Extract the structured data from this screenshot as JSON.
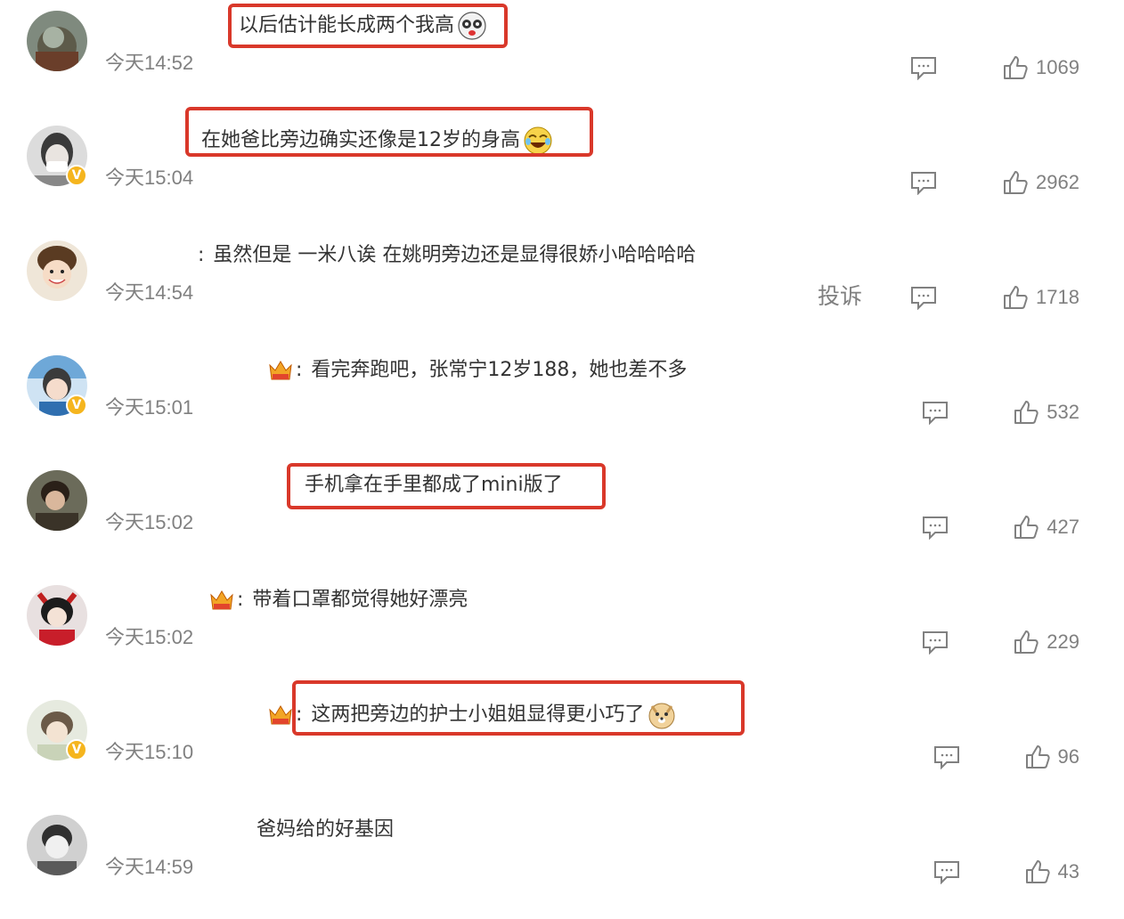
{
  "comments": [
    {
      "text": "以后估计能长成两个我高",
      "time": "今天14:52",
      "likes": "1069",
      "verified": false,
      "crown": false,
      "emoji": "panda-face-emoji",
      "highlighted": true,
      "report": ""
    },
    {
      "text": "在她爸比旁边确实还像是12岁的身高",
      "time": "今天15:04",
      "likes": "2962",
      "verified": true,
      "crown": false,
      "emoji": "laughing-tears-emoji",
      "highlighted": true,
      "report": ""
    },
    {
      "text": "虽然但是 一米八诶 在姚明旁边还是显得很娇小哈哈哈哈",
      "time": "今天14:54",
      "likes": "1718",
      "verified": false,
      "crown": false,
      "emoji": "",
      "highlighted": false,
      "report": "投诉"
    },
    {
      "text": "看完奔跑吧，张常宁12岁188，她也差不多",
      "time": "今天15:01",
      "likes": "532",
      "verified": true,
      "crown": true,
      "emoji": "",
      "highlighted": false,
      "report": ""
    },
    {
      "text": "手机拿在手里都成了mini版了",
      "time": "今天15:02",
      "likes": "427",
      "verified": false,
      "crown": false,
      "emoji": "",
      "highlighted": true,
      "report": ""
    },
    {
      "text": "带着口罩都觉得她好漂亮",
      "time": "今天15:02",
      "likes": "229",
      "verified": false,
      "crown": true,
      "emoji": "",
      "highlighted": false,
      "report": ""
    },
    {
      "text": "这两把旁边的护士小姐姐显得更小巧了",
      "time": "今天15:10",
      "likes": "96",
      "verified": true,
      "crown": true,
      "emoji": "doge-emoji",
      "highlighted": true,
      "report": ""
    },
    {
      "text": "爸妈给的好基因",
      "time": "今天14:59",
      "likes": "43",
      "verified": false,
      "crown": false,
      "emoji": "",
      "highlighted": false,
      "report": ""
    }
  ],
  "colors": {
    "highlight_border": "#d9382a",
    "verified_badge": "#f5b51e",
    "meta_gray": "#808080",
    "text": "#333333"
  },
  "icons": {
    "reply": "comment-bubble-icon",
    "like": "thumbs-up-icon",
    "verified": "verified-v-badge-icon",
    "crown": "crown-fan-badge-icon"
  }
}
